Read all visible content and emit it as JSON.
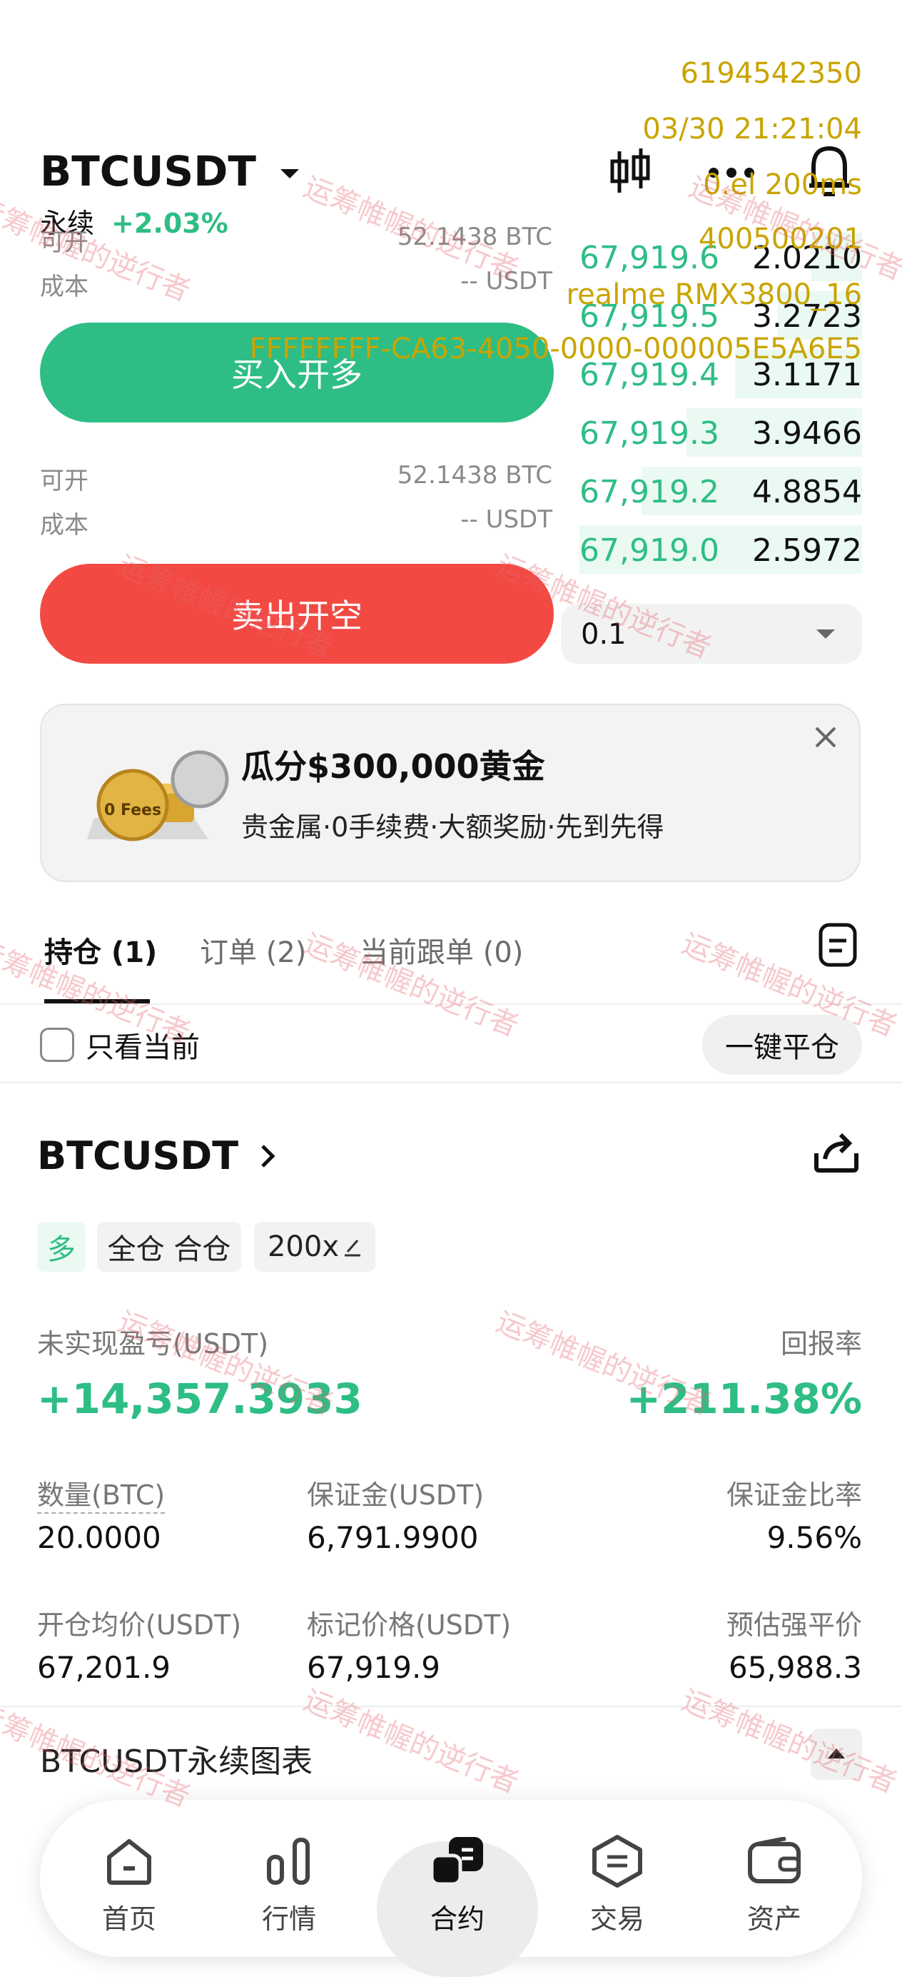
{
  "overlay": {
    "line1": "6194542350",
    "line2": "03/30 21:21:04",
    "line3": "0.el 200ms",
    "line4": "400500201",
    "line5": "realme RMX3800_16",
    "line6": "FFFFFFFF-CA63-4050-0000-000005E5A6E5"
  },
  "watermark": "运筹帷幄的逆行者",
  "header": {
    "symbol": "BTCUSDT",
    "type_label": "永续",
    "change": "+2.03%"
  },
  "buy_section": {
    "available_label": "可开",
    "available_value": "52.1438 BTC",
    "cost_label": "成本",
    "cost_value": "-- USDT",
    "button": "买入开多"
  },
  "sell_section": {
    "available_label": "可开",
    "available_value": "52.1438 BTC",
    "cost_label": "成本",
    "cost_value": "-- USDT",
    "button": "卖出开空"
  },
  "orderbook": [
    {
      "price": "67,919.6",
      "qty": "2.0210",
      "depth": 0.18
    },
    {
      "price": "67,919.5",
      "qty": "3.2723",
      "depth": 0.3
    },
    {
      "price": "67,919.4",
      "qty": "3.1171",
      "depth": 0.45
    },
    {
      "price": "67,919.3",
      "qty": "3.9466",
      "depth": 0.62
    },
    {
      "price": "67,919.2",
      "qty": "4.8854",
      "depth": 0.78
    },
    {
      "price": "67,919.0",
      "qty": "2.5972",
      "depth": 1.0
    }
  ],
  "precision_select": {
    "value": "0.1"
  },
  "promo": {
    "title": "瓜分$300,000黄金",
    "subtitle": "贵金属·0手续费·大额奖励·先到先得",
    "image_text": "0 Fees"
  },
  "tabs": [
    {
      "label": "持仓 (1)",
      "active": true
    },
    {
      "label": "订单 (2)",
      "active": false
    },
    {
      "label": "当前跟单 (0)",
      "active": false
    }
  ],
  "filter": {
    "checkbox_label": "只看当前",
    "close_all": "一键平仓"
  },
  "position": {
    "symbol": "BTCUSDT",
    "side_tag": "多",
    "mode_tag": "全仓 合仓",
    "leverage_tag": "200x",
    "pnl_label": "未实现盈亏(USDT)",
    "pnl_value": "+14,357.3933",
    "roe_label": "回报率",
    "roe_value": "+211.38%",
    "qty_label": "数量(BTC)",
    "qty_value": "20.0000",
    "margin_label": "保证金(USDT)",
    "margin_value": "6,791.9900",
    "margin_ratio_label": "保证金比率",
    "margin_ratio_value": "9.56%",
    "entry_label": "开仓均价(USDT)",
    "entry_value": "67,201.9",
    "mark_label": "标记价格(USDT)",
    "mark_value": "67,919.9",
    "liq_label": "预估强平价",
    "liq_value": "65,988.3"
  },
  "chart_section": {
    "title": "BTCUSDT永续图表"
  },
  "bottom_nav": [
    {
      "label": "首页",
      "icon": "home-icon",
      "active": false
    },
    {
      "label": "行情",
      "icon": "bar-chart-icon",
      "active": false
    },
    {
      "label": "合约",
      "icon": "contract-icon",
      "active": true
    },
    {
      "label": "交易",
      "icon": "exchange-icon",
      "active": false
    },
    {
      "label": "资产",
      "icon": "wallet-icon",
      "active": false
    }
  ],
  "colors": {
    "green": "#2ebd85",
    "red": "#f24a43",
    "overlay": "#c9a400"
  }
}
